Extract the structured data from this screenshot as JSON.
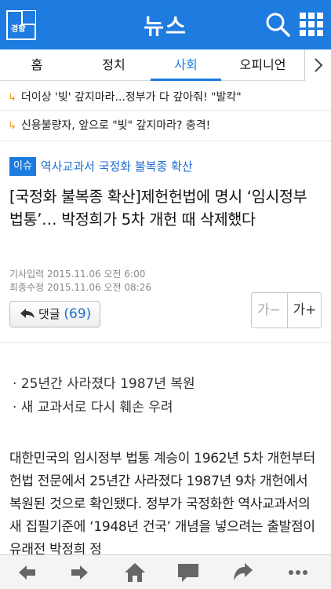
{
  "header": {
    "logo_text": "경향",
    "title": "뉴스"
  },
  "tabs": [
    {
      "label": "홈"
    },
    {
      "label": "정치"
    },
    {
      "label": "사회"
    },
    {
      "label": "오피니언"
    }
  ],
  "related": [
    {
      "text": "더이상 '빚' 갚지마라...정부가 다 갚아줘! \"발칵\""
    },
    {
      "text": "신용불량자, 앞으로 \"빚\" 갚지마라? 충격!"
    }
  ],
  "issue": {
    "badge": "이슈",
    "text": "역사교과서 국정화 불복종 확산"
  },
  "article": {
    "headline": "[국정화 불복종 확산]제헌헌법에 명시 ‘임시정부 법통’… 박정희가 5차 개헌 때 삭제했다",
    "published": "기사입력  2015.11.06 오전 6:00",
    "modified": "최종수정  2015.11.06 오전 08:26",
    "comment_label": "댓글",
    "comment_count": "(69)",
    "summary": [
      "· 25년간 사라졌다 1987년 복원",
      "· 새 교과서로 다시 훼손 우려"
    ],
    "body": "대한민국의 임시정부 법통 계승이 1962년 5차 개헌부터 헌법 전문에서 25년간 사라졌다 1987년 9차 개헌에서 복원된 것으로 확인됐다. 정부가 국정화한 역사교과서의 새 집필기준에 ‘1948년 건국’ 개념을 넣으려는 출발점이 유래전 박정희 정"
  },
  "font_size": {
    "minus_label": "가−",
    "plus_label": "가+"
  },
  "colors": {
    "brand": "#1e7be0",
    "arrow": "#f39a1e"
  }
}
